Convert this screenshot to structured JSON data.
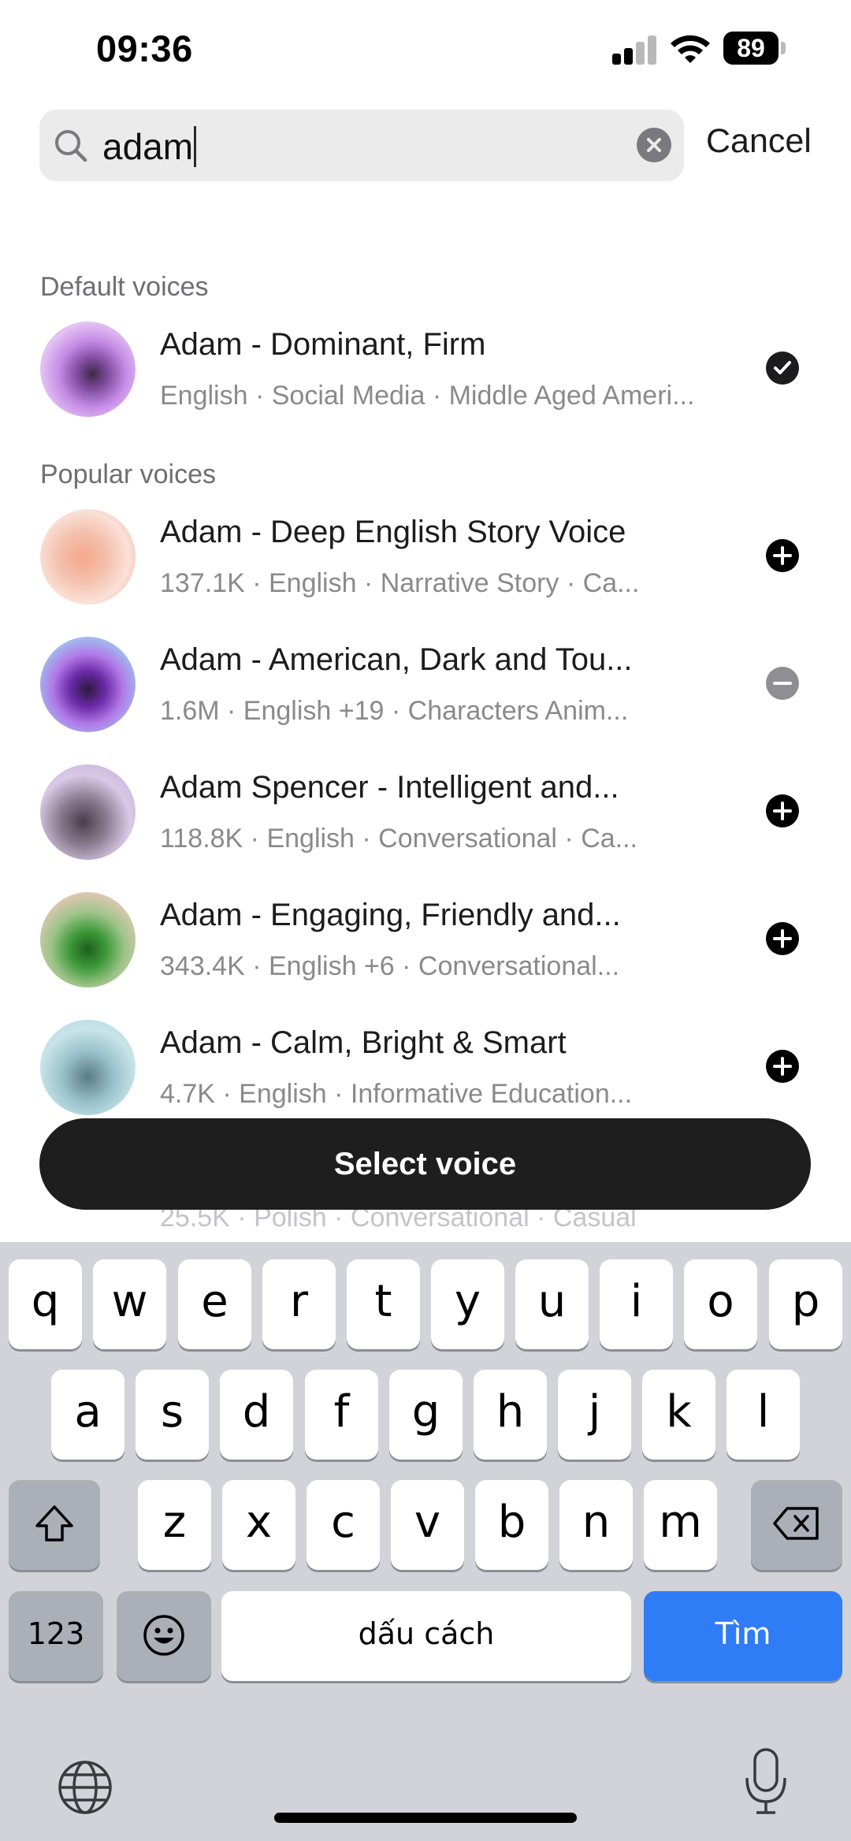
{
  "status_bar": {
    "time": "09:36",
    "battery": "89"
  },
  "search": {
    "value": "adam",
    "cancel_label": "Cancel"
  },
  "sections": {
    "default_label": "Default voices",
    "popular_label": "Popular voices"
  },
  "default_voice": {
    "name": "Adam - Dominant, Firm",
    "meta": "English · Social Media · Middle Aged Ameri...",
    "state": "selected"
  },
  "popular_voices": [
    {
      "name": "Adam - Deep English Story Voice",
      "meta": "137.1K · English · Narrative Story · Ca...",
      "state": "add"
    },
    {
      "name": "Adam - American, Dark and Tou...",
      "meta": "1.6M · English +19 · Characters Anim...",
      "state": "remove"
    },
    {
      "name": "Adam Spencer - Intelligent and...",
      "meta": "118.8K · English · Conversational · Ca...",
      "state": "add"
    },
    {
      "name": "Adam - Engaging, Friendly and...",
      "meta": "343.4K · English +6 · Conversational...",
      "state": "add"
    },
    {
      "name": "Adam - Calm, Bright & Smart",
      "meta": "4.7K · English · Informative Education...",
      "state": "add"
    }
  ],
  "partial_row_meta": "25.5K · Polish · Conversational · Casual",
  "select_button_label": "Select voice",
  "keyboard": {
    "row1": [
      "q",
      "w",
      "e",
      "r",
      "t",
      "y",
      "u",
      "i",
      "o",
      "p"
    ],
    "row2": [
      "a",
      "s",
      "d",
      "f",
      "g",
      "h",
      "j",
      "k",
      "l"
    ],
    "row3": [
      "z",
      "x",
      "c",
      "v",
      "b",
      "n",
      "m"
    ],
    "numbers_label": "123",
    "space_label": "dấu cách",
    "search_label": "Tìm"
  },
  "icons": {
    "search": "search-icon",
    "clear": "clear-icon",
    "selected": "checkmark-icon",
    "add": "plus-icon",
    "remove": "minus-icon",
    "shift": "shift-icon",
    "backspace": "backspace-icon",
    "emoji": "emoji-icon",
    "globe": "globe-icon",
    "mic": "microphone-icon"
  },
  "colors": {
    "accent_blue": "#2f7cf6",
    "button_dark": "#1e1e1e",
    "remove_gray": "#8e8e93"
  }
}
